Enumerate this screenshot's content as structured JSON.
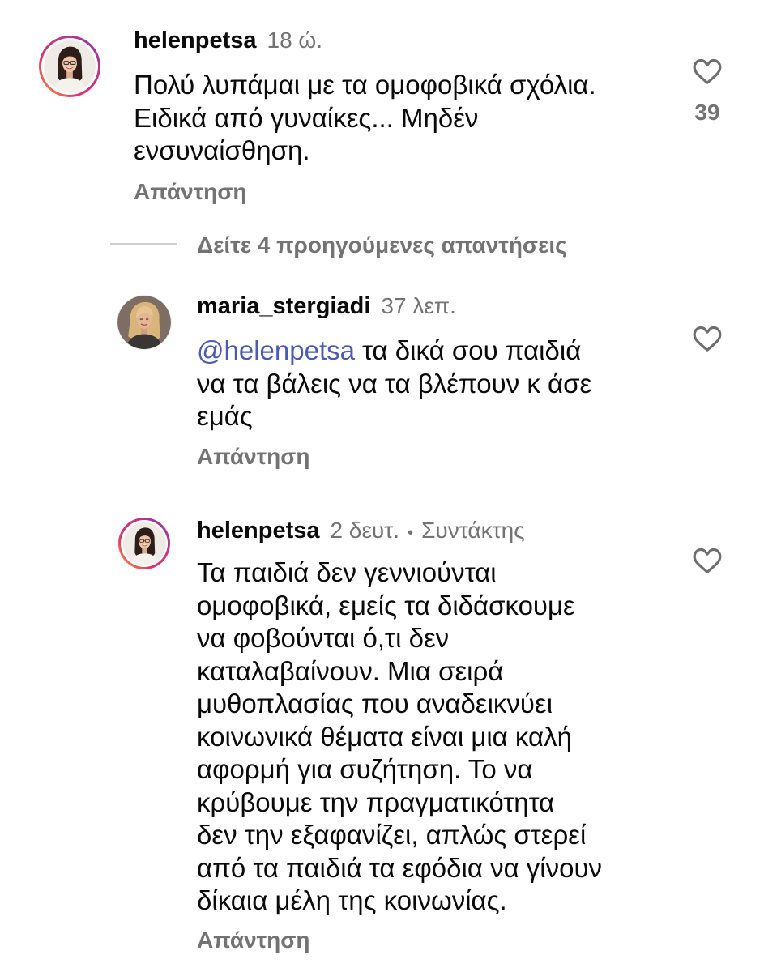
{
  "comments": [
    {
      "username": "helenpetsa",
      "time": "18 ώ.",
      "lines": [
        "Πολύ λυπάμαι με τα ομοφοβικά σχόλια.",
        "Ειδικά από γυναίκες... Μηδέν",
        "ενσυναίσθηση."
      ],
      "reply_label": "Απάντηση",
      "likes": "39",
      "liked": false,
      "has_story_ring": true
    }
  ],
  "view_previous_replies": "Δείτε 4 προηγούμενες απαντήσεις",
  "replies": [
    {
      "username": "maria_stergiadi",
      "time": "37 λεπ.",
      "mention": "@helenpetsa",
      "lines": [
        "τα δικά σου παιδιά",
        "να τα βάλεις να τα βλέπουν κ άσε",
        "εμάς"
      ],
      "reply_label": "Απάντηση",
      "liked": false,
      "has_story_ring": false
    },
    {
      "username": "helenpetsa",
      "time": "2 δευτ.",
      "separator": "•",
      "role": "Συντάκτης",
      "lines": [
        "Τα παιδιά δεν γεννιούνται",
        "ομοφοβικά, εμείς τα διδάσκουμε",
        "να φοβούνται ό,τι δεν",
        "καταλαβαίνουν. Μια σειρά",
        "μυθοπλασίας που αναδεικνύει",
        "κοινωνικά θέματα είναι μια καλή",
        "αφορμή για συζήτηση. Το να",
        "κρύβουμε την πραγματικότητα",
        "δεν την εξαφανίζει, απλώς στερεί",
        "από τα παιδιά τα εφόδια να γίνουν",
        "δίκαια μέλη της κοινωνίας."
      ],
      "reply_label": "Απάντηση",
      "liked": false,
      "has_story_ring": true
    }
  ],
  "icons": {
    "like": "heart-outline-icon"
  },
  "colors": {
    "background": "#ffffff",
    "text": "#0a0a0a",
    "secondary": "#737373",
    "mention": "#4b5bb4",
    "divider": "#cfcfcf",
    "like_icon": "#6e6e6e",
    "story_ring": [
      "#f9a03f",
      "#e1306c",
      "#c13584",
      "#833ab4"
    ]
  }
}
